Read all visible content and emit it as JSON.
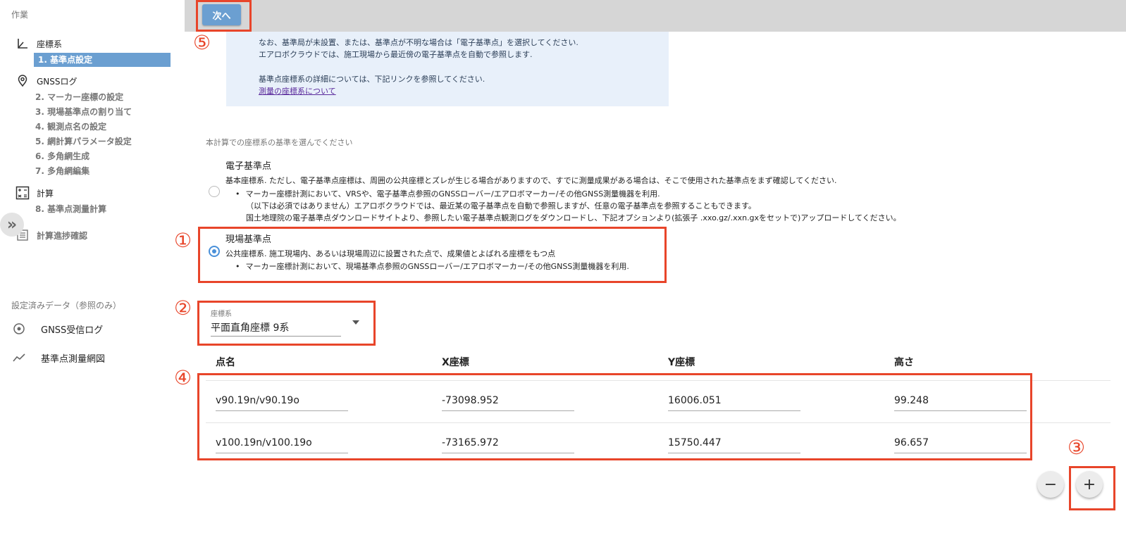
{
  "sidebar": {
    "header": "作業",
    "groups": [
      {
        "label": "座標系",
        "icon": "axis-icon"
      },
      {
        "label": "GNSSログ",
        "icon": "location-pin-icon"
      },
      {
        "label": "計算",
        "icon": "calculator-icon"
      },
      {
        "label": "計算進捗確認",
        "icon": "list-icon"
      }
    ],
    "steps": [
      {
        "label": "1. 基準点設定",
        "active": true
      },
      {
        "label": "2. マーカー座標の設定"
      },
      {
        "label": "3. 現場基準点の割り当て"
      },
      {
        "label": "4. 観測点名の設定"
      },
      {
        "label": "5. 網計算パラメータ設定"
      },
      {
        "label": "6. 多角網生成"
      },
      {
        "label": "7. 多角網編集"
      },
      {
        "label": "8. 基準点測量計算"
      }
    ],
    "collapse_glyph": "»",
    "data_section_title": "設定済みデータ（参照のみ）",
    "data_items": [
      {
        "label": "GNSS受信ログ",
        "icon": "target-icon"
      },
      {
        "label": "基準点測量網図",
        "icon": "trend-line-icon"
      }
    ]
  },
  "toolbar": {
    "next_label": "次へ"
  },
  "info": {
    "line1": "なお、基準局が未設置、または、基準点が不明な場合は「電子基準点」を選択してください.",
    "line2": "エアロボクラウドでは、施工現場から最近傍の電子基準点を自動で参照します.",
    "line3": "基準点座標系の詳細については、下記リンクを参照してください.",
    "link": "測量の座標系について"
  },
  "coord_basis": {
    "prompt": "本計算での座標系の基準を選んでください",
    "option1": {
      "title": "電子基準点",
      "desc": "基本座標系. ただし、電子基準点座標は、周囲の公共座標とズレが生じる場合がありますので、すでに測量成果がある場合は、そこで使用された基準点をまず確認してください.",
      "bullet": "マーカー座標計測において、VRSや、電子基準点参照のGNSSローバー/エアロボマーカー/その他GNSS測量機器を利用.",
      "note1": "（以下は必須ではありません）エアロボクラウドでは、最近某の電子基準点を自動で参照しますが、任意の電子基準点を参照することもできます。",
      "note2": "国土地理院の電子基準点ダウンロードサイトより、参照したい電子基準点観測ログをダウンロードし、下記オプションより(拡張子 .xxo.gz/.xxn.gxをセットで)アップロードしてください。",
      "selected": false
    },
    "option2": {
      "title": "現場基準点",
      "desc": "公共座標系. 施工現場内、あるいは現場周辺に設置された点で、成果値とよばれる座標をもつ点",
      "bullet": "マーカー座標計測において、現場基準点参照のGNSSローバー/エアロボマーカー/その他GNSS測量機器を利用.",
      "selected": true
    }
  },
  "crs_select": {
    "label": "座標系",
    "value": "平面直角座標 9系"
  },
  "table": {
    "headers": [
      "点名",
      "X座標",
      "Y座標",
      "高さ"
    ],
    "rows": [
      [
        "v90.19n/v90.19o",
        "-73098.952",
        "16006.051",
        "99.248"
      ],
      [
        "v100.19n/v100.19o",
        "-73165.972",
        "15750.447",
        "96.657"
      ]
    ]
  },
  "controls": {
    "remove_glyph": "−",
    "add_glyph": "+"
  },
  "annotations": {
    "n1": "①",
    "n2": "②",
    "n3": "③",
    "n4": "④",
    "n5": "⑤",
    "color": "#e8452a"
  },
  "colors": {
    "accent": "#6b9fd1",
    "info_bg": "#e8f0fa",
    "topbar": "#d6d6d6"
  }
}
